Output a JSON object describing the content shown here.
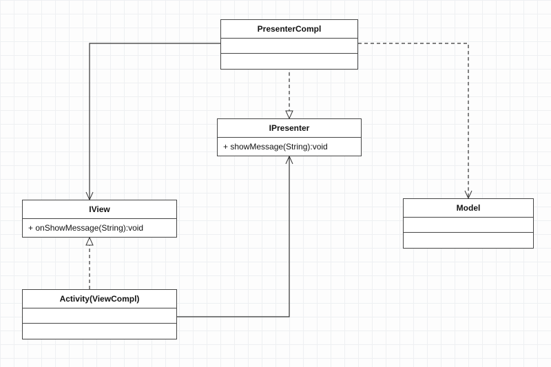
{
  "diagram": {
    "classes": {
      "presenterCompl": {
        "name": "PresenterCompl",
        "attributes": [],
        "operations": []
      },
      "ipresenter": {
        "name": "IPresenter",
        "attributes": [],
        "operations": [
          "+ showMessage(String):void"
        ]
      },
      "iview": {
        "name": "IView",
        "attributes": [],
        "operations": [
          "+ onShowMessage(String):void"
        ]
      },
      "model": {
        "name": "Model",
        "attributes": [],
        "operations": []
      },
      "activity": {
        "name": "Activity(ViewCompl)",
        "attributes": [],
        "operations": []
      }
    },
    "edges": [
      {
        "from": "presenterCompl",
        "to": "iview",
        "kind": "association-solid-open-arrow"
      },
      {
        "from": "presenterCompl",
        "to": "ipresenter",
        "kind": "realization-dashed-hollow-arrow"
      },
      {
        "from": "presenterCompl",
        "to": "model",
        "kind": "dependency-dashed-open-arrow"
      },
      {
        "from": "activity",
        "to": "ipresenter",
        "kind": "association-solid-open-arrow"
      },
      {
        "from": "activity",
        "to": "iview",
        "kind": "realization-dashed-hollow-arrow"
      }
    ]
  }
}
